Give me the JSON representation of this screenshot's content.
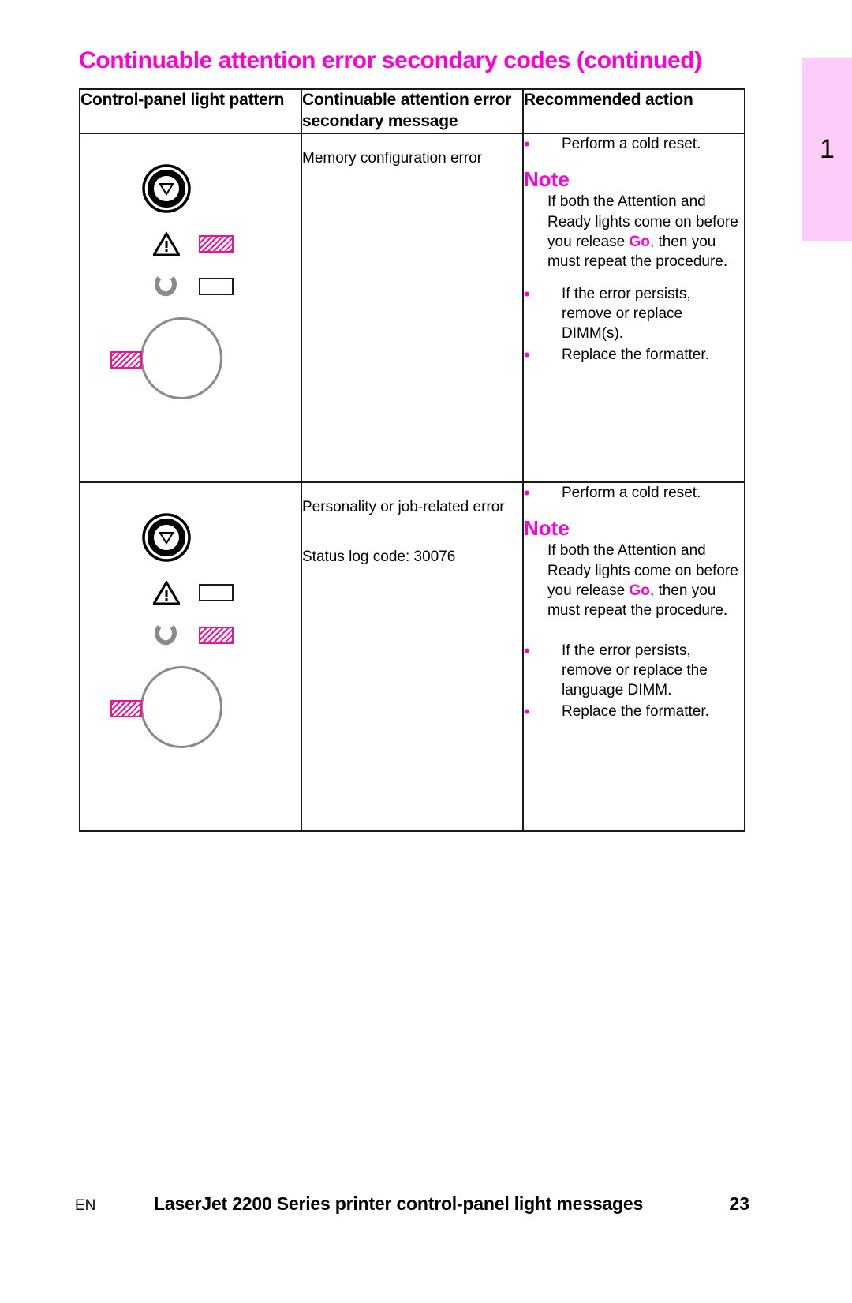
{
  "page": {
    "title": "Continuable attention error secondary codes (continued)",
    "tab_number": "1",
    "accent_color": "#ff00d4",
    "led_on_color": "#ee1296",
    "tab_color": "#ffccfa"
  },
  "table": {
    "headers": [
      "Control-panel light pattern",
      "Continuable attention error secondary message",
      "Recommended action"
    ],
    "rows": [
      {
        "pattern": {
          "go_button_icon": "go-button-icon",
          "attention_icon": "warning-triangle-icon",
          "attention_led": "on",
          "ready_icon": "ready-arc-icon",
          "ready_led": "off",
          "toner_circle_icon": "toner-circle-icon",
          "toner_led": "on"
        },
        "message": "Memory configuration error",
        "message_secondary": "",
        "actions_top": [
          "Perform a cold reset."
        ],
        "note_heading": "Note",
        "note_before": "If both the Attention and Ready lights come on before you release ",
        "note_keyword": "Go",
        "note_after": ", then you must repeat the procedure.",
        "actions_bottom": [
          "If the error persists, remove or replace DIMM(s).",
          "Replace the formatter."
        ]
      },
      {
        "pattern": {
          "go_button_icon": "go-button-icon",
          "attention_icon": "warning-triangle-icon",
          "attention_led": "off",
          "ready_icon": "ready-arc-icon",
          "ready_led": "on",
          "toner_circle_icon": "toner-circle-icon",
          "toner_led": "on"
        },
        "message": "Personality or job-related error",
        "message_secondary": "Status log code: 30076",
        "actions_top": [
          "Perform a cold reset."
        ],
        "note_heading": "Note",
        "note_before": "If both the Attention and Ready lights come on before you release ",
        "note_keyword": "Go",
        "note_after": ", then you must repeat the procedure.",
        "actions_bottom": [
          "If the error persists, remove or replace the language DIMM.",
          "Replace the formatter."
        ]
      }
    ]
  },
  "footer": {
    "language": "EN",
    "title": "LaserJet 2200 Series printer control-panel light messages",
    "page_number": "23"
  }
}
